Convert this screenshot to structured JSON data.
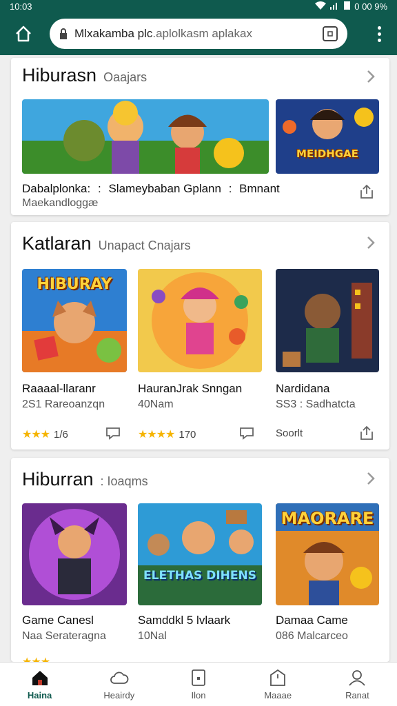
{
  "status": {
    "time": "10:03",
    "battery": "0 00 9%"
  },
  "browser": {
    "url_main": "Mlxakamba plc",
    "url_rest": ".aplolkasm aplakax"
  },
  "sections": [
    {
      "title": "Hiburasn",
      "subtitle": "Oaajars",
      "items": [
        {
          "title": "Dabalplonka:",
          "sep": ":",
          "title2": "Slameybaban Gplann",
          "sep2": ":",
          "title3": "Bmnant",
          "subtitle": "Maekandloggæ",
          "art_text": ""
        },
        {
          "title": "",
          "subtitle": "",
          "art_text": "MEIDHGAE"
        }
      ]
    },
    {
      "title": "Katlaran",
      "subtitle": "Unapact Cnajars",
      "items": [
        {
          "title": "Raaaal-llaranr",
          "subtitle": "2S1 Rareoanzqn",
          "rating": "1/6",
          "art_text": "HIBURAY"
        },
        {
          "title": "HauranJrak Snngan",
          "subtitle": "40Nam",
          "rating": "170",
          "art_text": ""
        },
        {
          "title": "Nardidana",
          "subtitle": "SS3 : Sadhatcta",
          "rating": "Soorlt",
          "art_text": ""
        }
      ]
    },
    {
      "title": "Hiburran",
      "subtitle": ": Ioaqms",
      "items": [
        {
          "title": "Game Canesl",
          "subtitle": "Naa Serateragna",
          "art_text": ""
        },
        {
          "title": "Samddkl 5 lvlaark",
          "subtitle": "10Nal",
          "art_text": "ELETHAS DIHENS"
        },
        {
          "title": "Damaa Came",
          "subtitle": "086 Malcarceo",
          "art_text": "MAORARE"
        }
      ]
    }
  ],
  "nav": [
    {
      "label": "Haina",
      "icon": "home-icon"
    },
    {
      "label": "Heairdy",
      "icon": "cloud-icon"
    },
    {
      "label": "Ilon",
      "icon": "tablet-icon"
    },
    {
      "label": "Maaae",
      "icon": "bag-icon"
    },
    {
      "label": "Ranat",
      "icon": "person-icon"
    }
  ],
  "colors": {
    "brand": "#0f5a4e",
    "star": "#f5b400"
  }
}
